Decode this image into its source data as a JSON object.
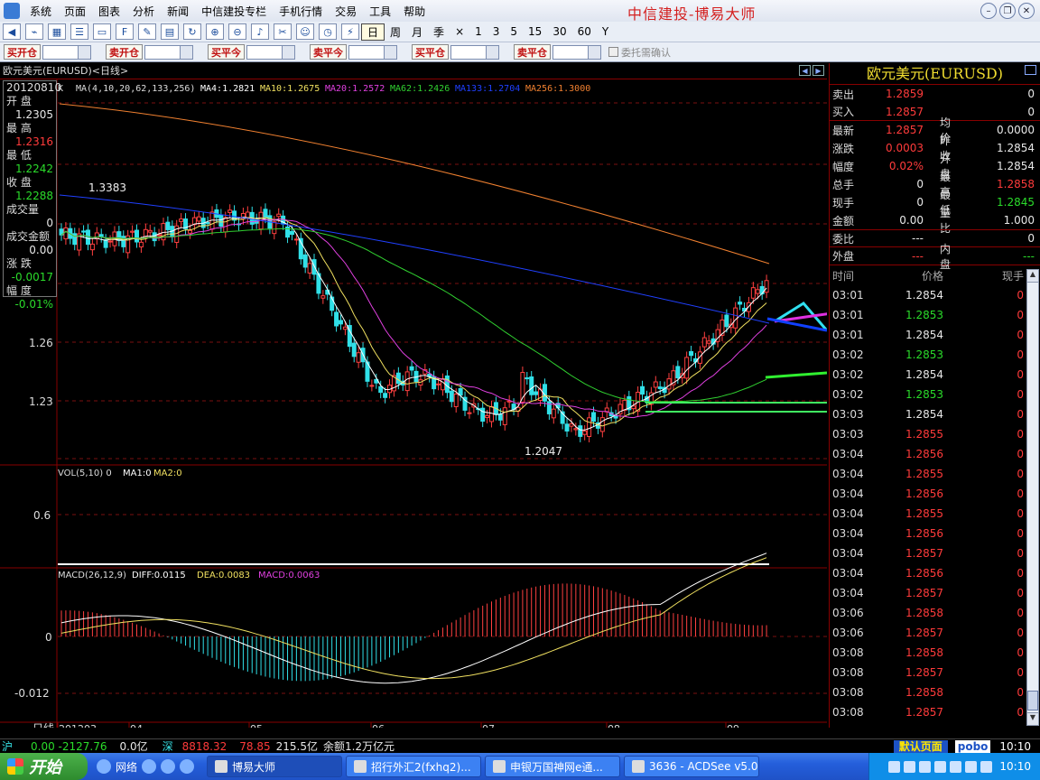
{
  "menu": {
    "items": [
      "系统",
      "页面",
      "图表",
      "分析",
      "新闻",
      "中信建投专栏",
      "手机行情",
      "交易",
      "工具",
      "帮助"
    ],
    "brand": "中信建投-博易大师"
  },
  "toolbar": {
    "periods": [
      "日",
      "周",
      "月",
      "季",
      "×",
      "1",
      "3",
      "5",
      "15",
      "30",
      "60",
      "Y"
    ],
    "active_period": "日"
  },
  "trade": {
    "buttons": [
      "买开仓",
      "卖开仓",
      "买平今",
      "卖平今",
      "买平仓",
      "卖平仓"
    ],
    "confirm_label": "委托需确认"
  },
  "chart": {
    "tab_title": "欧元美元(EURUSD)<日线>",
    "ma_header": {
      "k": "K",
      "params": "MA(4,10,20,62,133,256)",
      "ma4": "MA4:1.2821",
      "ma10": "MA10:1.2675",
      "ma20": "MA20:1.2572",
      "ma62": "MA62:1.2426",
      "ma133": "MA133:1.2704",
      "ma256": "MA256:1.3000"
    },
    "price_labels": [
      "1.26",
      "1.23"
    ],
    "high_annot": "1.3383",
    "low_annot": "1.2047",
    "vol_header": {
      "params": "VOL(5,10) 0",
      "ma1": "MA1:0",
      "ma2": "MA2:0"
    },
    "vol_label": "0.6",
    "macd_header": {
      "params": "MACD(26,12,9)",
      "diff": "DIFF:0.0115",
      "dea": "DEA:0.0083",
      "macd": "MACD:0.0063"
    },
    "macd_labels": [
      "0",
      "-0.012"
    ],
    "x_axis": {
      "name": "日线",
      "labels": [
        "201203",
        "04",
        "05",
        "06",
        "07",
        "08",
        "09"
      ]
    },
    "colors": {
      "ma4": "#ffffff",
      "ma10": "#f0e060",
      "ma20": "#e040e0",
      "ma62": "#30d030",
      "ma133": "#2040ff",
      "ma256": "#f08030",
      "up": "#ff4040",
      "down": "#30e0e8"
    }
  },
  "leftinfo": {
    "date": "20120810",
    "rows": [
      {
        "label": "开 盘",
        "value": "1.2305",
        "color": "white"
      },
      {
        "label": "最 高",
        "value": "1.2316",
        "color": "red"
      },
      {
        "label": "最 低",
        "value": "1.2242",
        "color": "green"
      },
      {
        "label": "收 盘",
        "value": "1.2288",
        "color": "green"
      },
      {
        "label": "成交量",
        "value": "0",
        "color": "white"
      },
      {
        "label": "成交金额",
        "value": "0.00",
        "color": "white"
      },
      {
        "label": "涨 跌",
        "value": "-0.0017",
        "color": "green"
      },
      {
        "label": "幅 度",
        "value": "-0.01%",
        "color": "green"
      }
    ]
  },
  "quote": {
    "title": "欧元美元(EURUSD)",
    "sell": {
      "label": "卖出",
      "price": "1.2859",
      "qty": "0"
    },
    "buy": {
      "label": "买入",
      "price": "1.2857",
      "qty": "0"
    },
    "rows": [
      {
        "l1": "最新",
        "v1": "1.2857",
        "c1": "red",
        "l2": "均价",
        "v2": "0.0000",
        "c2": "white"
      },
      {
        "l1": "涨跌",
        "v1": "0.0003",
        "c1": "red",
        "l2": "昨收",
        "v2": "1.2854",
        "c2": "white"
      },
      {
        "l1": "幅度",
        "v1": "0.02%",
        "c1": "red",
        "l2": "开盘",
        "v2": "1.2854",
        "c2": "white"
      },
      {
        "l1": "总手",
        "v1": "0",
        "c1": "white",
        "l2": "最高",
        "v2": "1.2858",
        "c2": "red"
      },
      {
        "l1": "现手",
        "v1": "0",
        "c1": "white",
        "l2": "最低",
        "v2": "1.2845",
        "c2": "green"
      },
      {
        "l1": "金额",
        "v1": "0.00",
        "c1": "white",
        "l2": "量比",
        "v2": "1.000",
        "c2": "white"
      }
    ],
    "wei_bi": {
      "label": "委比",
      "value": "---",
      "qty": "0"
    },
    "pan": {
      "label1": "外盘",
      "value1": "---",
      "label2": "内盘",
      "value2": "---"
    },
    "ticks_header": {
      "time": "时间",
      "price": "价格",
      "qty": "现手"
    },
    "ticks": [
      {
        "t": "03:01",
        "p": "1.2854",
        "c": "white",
        "q": "0"
      },
      {
        "t": "03:01",
        "p": "1.2853",
        "c": "green",
        "q": "0"
      },
      {
        "t": "03:01",
        "p": "1.2854",
        "c": "white",
        "q": "0"
      },
      {
        "t": "03:02",
        "p": "1.2853",
        "c": "green",
        "q": "0"
      },
      {
        "t": "03:02",
        "p": "1.2854",
        "c": "white",
        "q": "0"
      },
      {
        "t": "03:02",
        "p": "1.2853",
        "c": "green",
        "q": "0"
      },
      {
        "t": "03:03",
        "p": "1.2854",
        "c": "white",
        "q": "0"
      },
      {
        "t": "03:03",
        "p": "1.2855",
        "c": "red",
        "q": "0"
      },
      {
        "t": "03:04",
        "p": "1.2856",
        "c": "red",
        "q": "0"
      },
      {
        "t": "03:04",
        "p": "1.2855",
        "c": "red",
        "q": "0"
      },
      {
        "t": "03:04",
        "p": "1.2856",
        "c": "red",
        "q": "0"
      },
      {
        "t": "03:04",
        "p": "1.2855",
        "c": "red",
        "q": "0"
      },
      {
        "t": "03:04",
        "p": "1.2856",
        "c": "red",
        "q": "0"
      },
      {
        "t": "03:04",
        "p": "1.2857",
        "c": "red",
        "q": "0"
      },
      {
        "t": "03:04",
        "p": "1.2856",
        "c": "red",
        "q": "0"
      },
      {
        "t": "03:04",
        "p": "1.2857",
        "c": "red",
        "q": "0"
      },
      {
        "t": "03:06",
        "p": "1.2858",
        "c": "red",
        "q": "0"
      },
      {
        "t": "03:06",
        "p": "1.2857",
        "c": "red",
        "q": "0"
      },
      {
        "t": "03:08",
        "p": "1.2858",
        "c": "red",
        "q": "0"
      },
      {
        "t": "03:08",
        "p": "1.2857",
        "c": "red",
        "q": "0"
      },
      {
        "t": "03:08",
        "p": "1.2858",
        "c": "red",
        "q": "0"
      },
      {
        "t": "03:08",
        "p": "1.2857",
        "c": "red",
        "q": "0"
      }
    ]
  },
  "status": {
    "sh_label": "沪",
    "sh_values": "0.00 -2127.76",
    "sh_amount": "0.0亿",
    "sz_label": "深",
    "sz_index": "8818.32",
    "sz_change": "78.85",
    "sz_amount": "215.5亿",
    "balance": "余额1.2万亿元",
    "default_page": "默认页面",
    "pobo": "pobo",
    "time": "10:10"
  },
  "taskbar": {
    "start": "开始",
    "network": "网络",
    "tasks": [
      "博易大师",
      "招行外汇2(fxhq2)...",
      "申银万国神网e通...",
      "3636 - ACDSee v5.0"
    ],
    "clock": "10:10"
  }
}
